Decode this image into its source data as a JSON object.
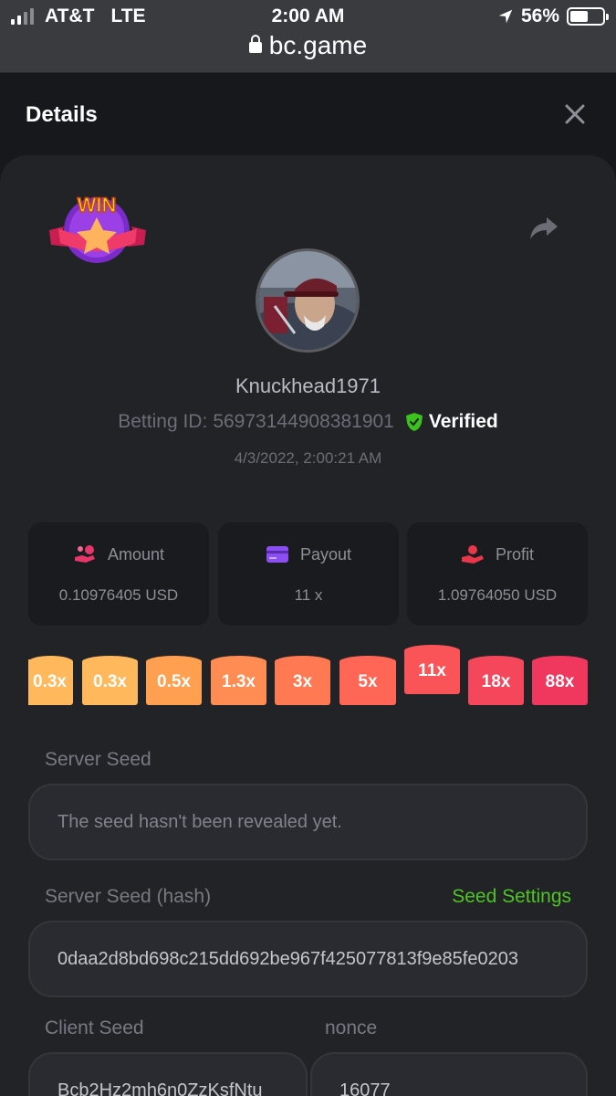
{
  "status_bar": {
    "carrier": "AT&T",
    "network": "LTE",
    "time": "2:00 AM",
    "battery": "56%",
    "battery_level": 0.56,
    "url": "bc.game"
  },
  "header": {
    "title": "Details"
  },
  "bet": {
    "win_badge_text": "WIN",
    "username": "Knuckhead1971",
    "betting_id_label": "Betting ID:",
    "betting_id": "56973144908381901",
    "verified_label": "Verified",
    "datetime": "4/3/2022, 2:00:21 AM"
  },
  "stats": [
    {
      "label": "Amount",
      "value": "0.10976405 USD",
      "icon": "coins-hand-icon",
      "icon_color": "#e8366a"
    },
    {
      "label": "Payout",
      "value": "11 x",
      "icon": "card-icon",
      "icon_color": "#8b4ef0"
    },
    {
      "label": "Profit",
      "value": "1.09764050 USD",
      "icon": "profit-hand-icon",
      "icon_color": "#e8364a"
    }
  ],
  "multipliers": [
    {
      "label": "0.3x",
      "color": "#ffb95c",
      "selected": false
    },
    {
      "label": "0.3x",
      "color": "#ffb95c",
      "selected": false
    },
    {
      "label": "0.5x",
      "color": "#ffa050",
      "selected": false
    },
    {
      "label": "1.3x",
      "color": "#ff8c52",
      "selected": false
    },
    {
      "label": "3x",
      "color": "#ff7a52",
      "selected": false
    },
    {
      "label": "5x",
      "color": "#ff6655",
      "selected": false
    },
    {
      "label": "11x",
      "color": "#fa5458",
      "selected": true
    },
    {
      "label": "18x",
      "color": "#f5475c",
      "selected": false
    },
    {
      "label": "88x",
      "color": "#f0385e",
      "selected": false
    }
  ],
  "seeds": {
    "server_seed_label": "Server Seed",
    "server_seed_value": "The seed hasn't been revealed yet.",
    "server_seed_hash_label": "Server Seed (hash)",
    "seed_settings_link": "Seed Settings",
    "server_seed_hash": "0daa2d8bd698c215dd692be967f425077813f9e85fe0203",
    "client_seed_label": "Client Seed",
    "client_seed": "Bcb2Hz2mh6n0ZzKsfNtu",
    "nonce_label": "nonce",
    "nonce": "16077"
  }
}
